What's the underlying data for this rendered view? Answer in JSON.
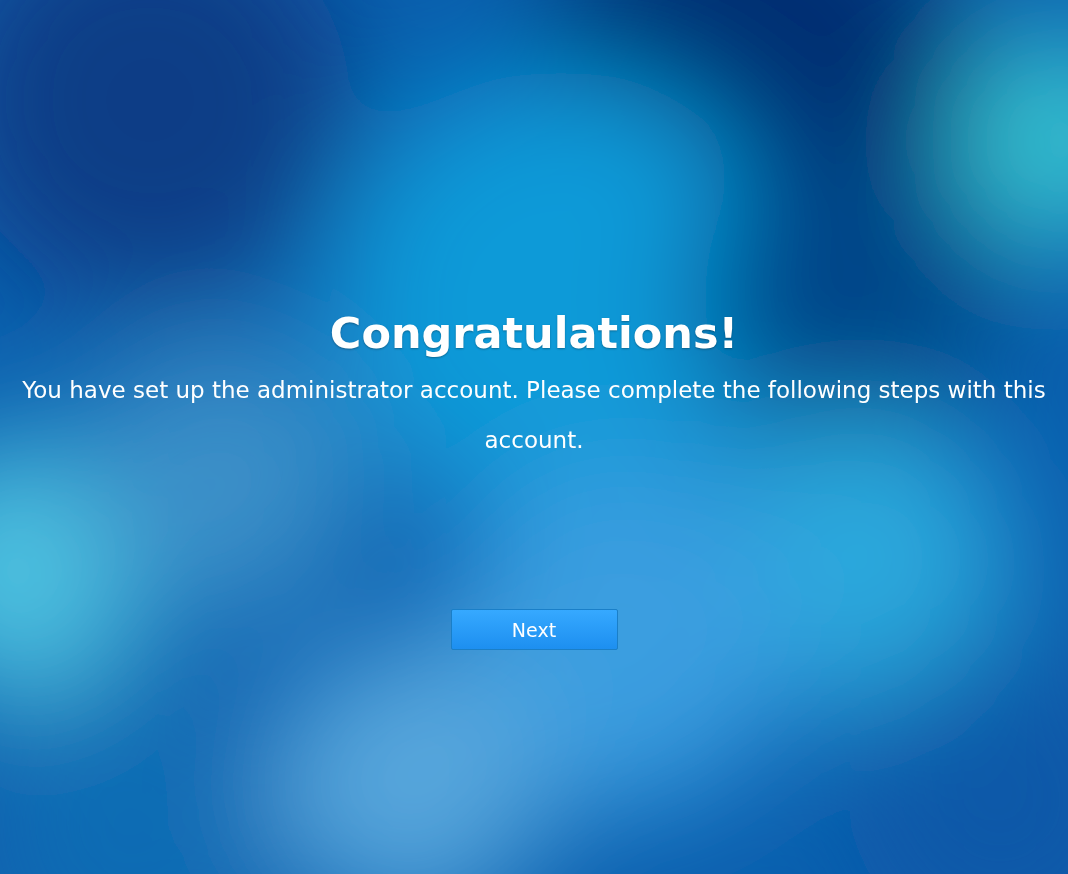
{
  "title": "Congratulations!",
  "message": "You have set up the administrator account. Please complete the following steps with this account.",
  "buttons": [
    {
      "label": "Next"
    }
  ]
}
